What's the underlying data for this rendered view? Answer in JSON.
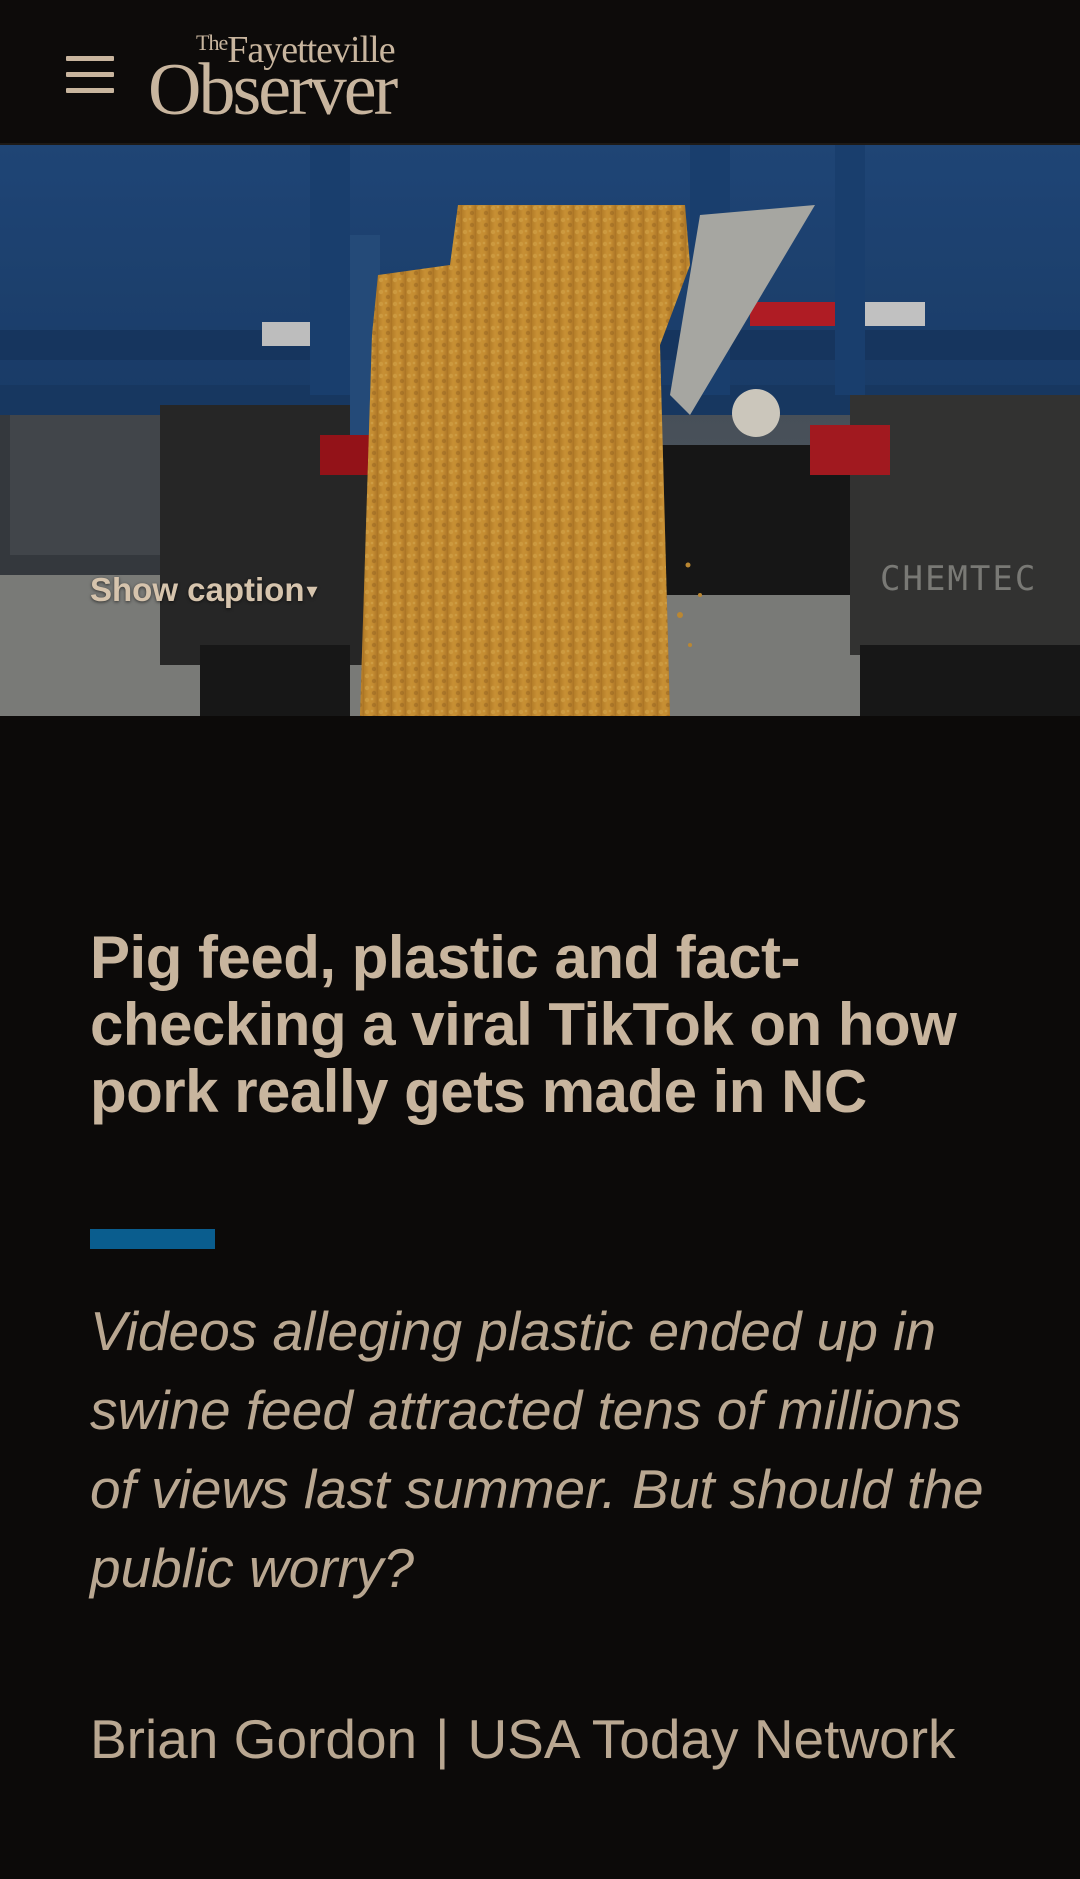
{
  "header": {
    "menu_label": "Menu",
    "logo": {
      "line1_the": "The",
      "line1_name": "Fayetteville",
      "line2": "Observer"
    }
  },
  "hero": {
    "show_caption": "Show caption",
    "caret": "▾",
    "truck_text": "CHEMTEC"
  },
  "article": {
    "headline": "Pig feed, plastic and fact-checking a viral TikTok on how pork really gets made in NC",
    "deck": "Videos alleging plastic ended up in swine feed attracted tens of millions of views last summer. But should the public worry?",
    "author": "Brian Gordon",
    "separator": "|",
    "outlet": "USA Today Network"
  },
  "colors": {
    "background": "#0c0a09",
    "text": "#c8b59e",
    "accent": "#0a5d8e"
  }
}
